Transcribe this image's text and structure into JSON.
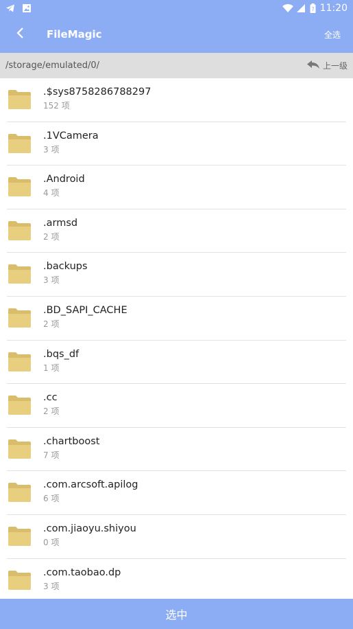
{
  "status_bar": {
    "time": "11:20",
    "icons": [
      "telegram-icon",
      "image-icon",
      "wifi-icon",
      "signal-icon",
      "battery-icon"
    ]
  },
  "app_bar": {
    "title": "FileMagic",
    "select_all_label": "全选",
    "back_icon": "chevron-left-icon",
    "color": "#8cacf4"
  },
  "path_bar": {
    "path": "/storage/emulated/0/",
    "up_label": "上一级",
    "up_icon": "reply-arrow-icon"
  },
  "files": [
    {
      "name": ".$sys8758286788297",
      "count": "152 项"
    },
    {
      "name": ".1VCamera",
      "count": "3 项"
    },
    {
      "name": ".Android",
      "count": "4 项"
    },
    {
      "name": ".armsd",
      "count": "2 项"
    },
    {
      "name": ".backups",
      "count": "3 项"
    },
    {
      "name": ".BD_SAPI_CACHE",
      "count": "2 项"
    },
    {
      "name": ".bqs_df",
      "count": "1 项"
    },
    {
      "name": ".cc",
      "count": "2 项"
    },
    {
      "name": ".chartboost",
      "count": "7 项"
    },
    {
      "name": ".com.arcsoft.apilog",
      "count": "6 项"
    },
    {
      "name": ".com.jiaoyu.shiyou",
      "count": "0 项"
    },
    {
      "name": ".com.taobao.dp",
      "count": "3 项"
    }
  ],
  "bottom_button": {
    "label": "选中"
  }
}
